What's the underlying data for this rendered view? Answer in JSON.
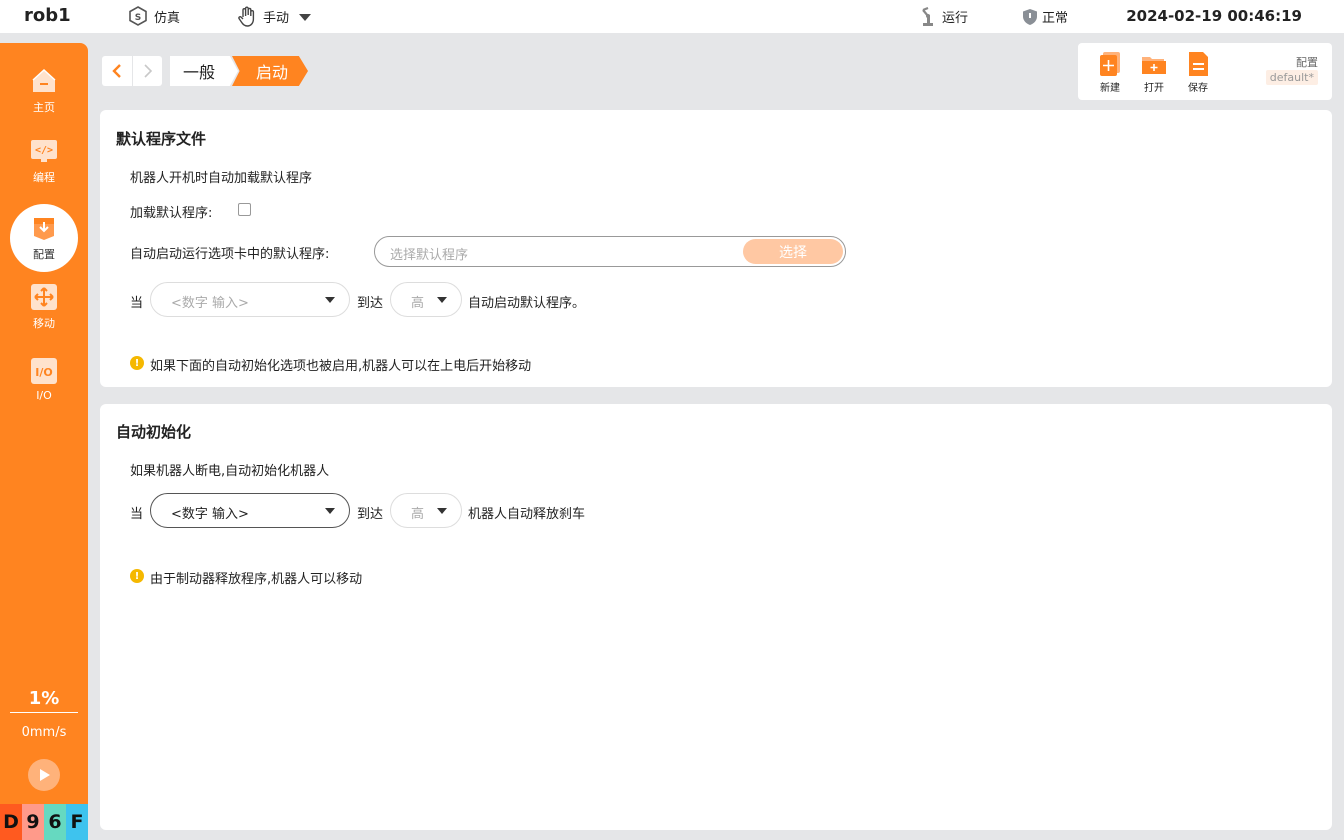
{
  "topbar": {
    "robot_name": "rob1",
    "sim_label": "仿真",
    "mode_label": "手动",
    "run_label": "运行",
    "status_label": "正常",
    "datetime": "2024-02-19 00:46:19"
  },
  "sidebar": {
    "items": [
      {
        "label": "主页",
        "icon": "home-icon"
      },
      {
        "label": "编程",
        "icon": "code-icon"
      },
      {
        "label": "配置",
        "icon": "config-icon"
      },
      {
        "label": "移动",
        "icon": "move-icon"
      },
      {
        "label": "I/O",
        "icon": "io-icon"
      }
    ],
    "speed_percent": "1%",
    "speed_value": "0mm/s",
    "tiles": [
      "D",
      "9",
      "6",
      "F"
    ]
  },
  "breadcrumb": {
    "items": [
      "一般",
      "启动"
    ]
  },
  "file_toolbar": {
    "new_label": "新建",
    "open_label": "打开",
    "save_label": "保存",
    "config_label": "配置",
    "config_value": "default*"
  },
  "default_program": {
    "title": "默认程序文件",
    "description": "机器人开机时自动加载默认程序",
    "load_label": "加载默认程序:",
    "autostart_label": "自动启动运行选项卡中的默认程序:",
    "program_placeholder": "选择默认程序",
    "select_button": "选择",
    "when_label": "当",
    "input_placeholder": "<数字 输入>",
    "reach_label": "到达",
    "level_value": "高",
    "trigger_suffix": "自动启动默认程序。",
    "info": "如果下面的自动初始化选项也被启用,机器人可以在上电后开始移动"
  },
  "auto_init": {
    "title": "自动初始化",
    "description": "如果机器人断电,自动初始化机器人",
    "when_label": "当",
    "input_value": "<数字 输入>",
    "reach_label": "到达",
    "level_value": "高",
    "trigger_suffix": "机器人自动释放刹车",
    "info": "由于制动器释放程序,机器人可以移动"
  },
  "colors": {
    "accent": "#ff8420",
    "background": "#e5e6e8",
    "info": "#f5b800",
    "tiles": [
      "#ff5a1f",
      "#ff9a8a",
      "#66d9c0",
      "#3ec3ee"
    ]
  }
}
